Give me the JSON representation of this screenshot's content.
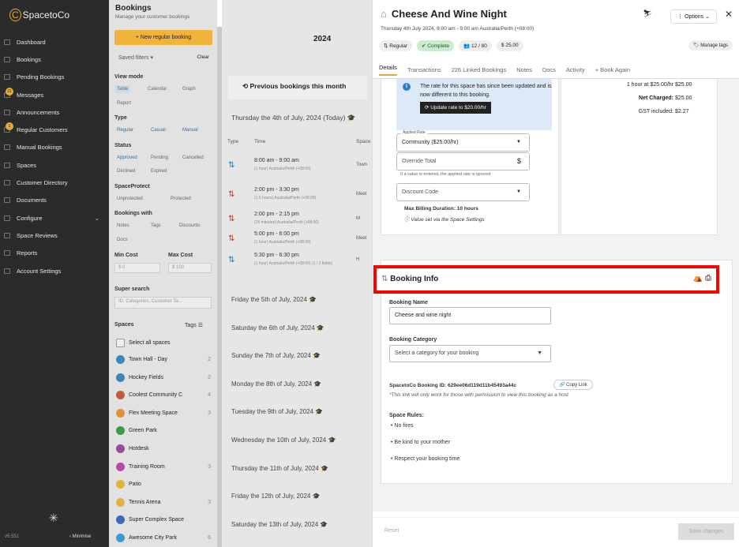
{
  "brand": "SpacetoCo",
  "sidebar": {
    "items": [
      {
        "label": "Dashboard"
      },
      {
        "label": "Bookings"
      },
      {
        "label": "Pending Bookings"
      },
      {
        "label": "Messages",
        "badge": "31"
      },
      {
        "label": "Announcements"
      },
      {
        "label": "Regular Customers",
        "badge": "1"
      },
      {
        "label": "Manual Bookings"
      },
      {
        "label": "Spaces"
      },
      {
        "label": "Customer Directory"
      },
      {
        "label": "Documents"
      },
      {
        "label": "Configure"
      },
      {
        "label": "Space Reviews"
      },
      {
        "label": "Reports"
      },
      {
        "label": "Account Settings"
      }
    ],
    "version": "v5.551",
    "minimise": "Minimise"
  },
  "bookings_panel": {
    "title": "Bookings",
    "subtitle": "Manage your customer bookings",
    "new_button": "+ New regular booking",
    "saved_filters": "Saved filters",
    "clear": "Clear",
    "view_mode": "View mode",
    "views": [
      "Table",
      "Calendar",
      "Graph",
      "Report"
    ],
    "type_label": "Type",
    "types": [
      "Regular",
      "Casual",
      "Manual"
    ],
    "status_label": "Status",
    "statuses": [
      "Approved",
      "Pending",
      "Cancelled",
      "Declined",
      "Expired"
    ],
    "spaceprotect_label": "SpaceProtect",
    "protect": [
      "Unprotected",
      "Protected"
    ],
    "bookings_with": "Bookings with",
    "with_items": [
      "Notes",
      "Tags",
      "Discounts",
      "Docs"
    ],
    "min_cost": "Min Cost",
    "max_cost": "Max Cost",
    "min_val": "$ 0",
    "max_val": "$ 100",
    "super_search": "Super search",
    "search_placeholder": "ID, Categories, Customer Ta...",
    "spaces_label": "Spaces",
    "tags_label": "Tags",
    "select_all": "Select all spaces",
    "spaces": [
      {
        "name": "Town Hall - Day",
        "color": "#3d86b8",
        "count": "2"
      },
      {
        "name": "Hockey Fields",
        "color": "#3d86b8",
        "count": "2"
      },
      {
        "name": "Coolest Community C",
        "color": "#c05a3a",
        "count": "4"
      },
      {
        "name": "Flex Meeting Space",
        "color": "#e0913a",
        "count": "3"
      },
      {
        "name": "Green Park",
        "color": "#3a9a4a",
        "count": ""
      },
      {
        "name": "Hotdesk",
        "color": "#9a4aa0",
        "count": ""
      },
      {
        "name": "Training Room",
        "color": "#b34aa8",
        "count": "3"
      },
      {
        "name": "Patio",
        "color": "#e0b43a",
        "count": ""
      },
      {
        "name": "Tennis Arena",
        "color": "#e0b43a",
        "count": "3"
      },
      {
        "name": "Super Complex Space",
        "color": "#3a6ab8",
        "count": ""
      },
      {
        "name": "Awesome City Park",
        "color": "#3a9ad0",
        "count": "6"
      }
    ]
  },
  "calendar": {
    "year": "2024",
    "prev": "Previous bookings this month",
    "today": "Thursday the 4th of July, 2024 (Today)",
    "cols": [
      "Type",
      "Time",
      "Space"
    ],
    "events": [
      {
        "time": "8:00 am - 9:00 am",
        "sub": "(1 hour) Australia/Perth (+08:00)",
        "loc": "Town",
        "color": "b"
      },
      {
        "time": "2:00 pm - 3:30 pm",
        "sub": "(1.5 hours) Australia/Perth (+08:00)",
        "loc": "Meet",
        "color": "r"
      },
      {
        "time": "2:00 pm - 2:15 pm",
        "sub": "(15 minutes) Australia/Perth (+08:00)",
        "loc": "M",
        "color": "r"
      },
      {
        "time": "5:00 pm - 6:00 pm",
        "sub": "(1 hour) Australia/Perth (+08:00)",
        "loc": "Meet",
        "color": "r"
      },
      {
        "time": "5:30 pm - 6:30 pm",
        "sub": "(1 hour) Australia/Perth (+08:00) (1 / 2 fields)",
        "loc": "H",
        "color": "b"
      }
    ],
    "days": [
      "Friday the 5th of July, 2024",
      "Saturday the 6th of July, 2024",
      "Sunday the 7th of July, 2024",
      "Monday the 8th of July, 2024",
      "Tuesday the 9th of July, 2024",
      "Wednesday the 10th of July, 2024",
      "Thursday the 11th of July, 2024",
      "Friday the 12th of July, 2024",
      "Saturday the 13th of July, 2024"
    ]
  },
  "detail": {
    "title": "Cheese And Wine Night",
    "datetime": "Thursday 4th July 2024, 8:00 am - 9:00 am Australia/Perth (+08:00)",
    "tags": [
      "Regular",
      "Complete",
      "12 / 80",
      "25.00"
    ],
    "manage_tags": "Manage tags",
    "options": "Options",
    "tabs": [
      "Details",
      "Transactions",
      "226 Linked Bookings",
      "Notes",
      "Docs",
      "Activity",
      "+ Book Again"
    ],
    "info_text": "The rate for this space has since been updated and is now different to this booking.",
    "update_button": "Update rate to $20.00/hr",
    "applied_rate_label": "Applied Rate",
    "applied_rate": "Community ($25.00/hr)",
    "override_total": "Override Total",
    "override_hint": "If a value is entered, the applied rate is ignored",
    "discount_code": "Discount Code",
    "max_billing": "Max Billing Duration: 10 hours",
    "value_via": "Value set via the Space Settings",
    "cost_rows": [
      {
        "label": "1 hour at $25.00/hr",
        "value": "$25.00"
      },
      {
        "label": "Net Charged:",
        "value": "$25.00"
      },
      {
        "label": "GST included:",
        "value": "$2.27"
      }
    ],
    "booking_info": "Booking Info",
    "booking_name_label": "Booking Name",
    "booking_name": "Cheese and wine night",
    "category_label": "Booking Category",
    "category_placeholder": "Select a category for your booking",
    "booking_id": "SpacetoCo Booking ID: 629ee06d119d11b45493a44c",
    "copy_link": "Copy Link",
    "id_hint": "*This link will only work for those with permission to view this booking as a host",
    "rules_label": "Space Rules:",
    "rules": [
      "No fires",
      "Be kind to your mother",
      "Respect your booking time"
    ],
    "reset": "Reset",
    "save": "Save changes"
  }
}
